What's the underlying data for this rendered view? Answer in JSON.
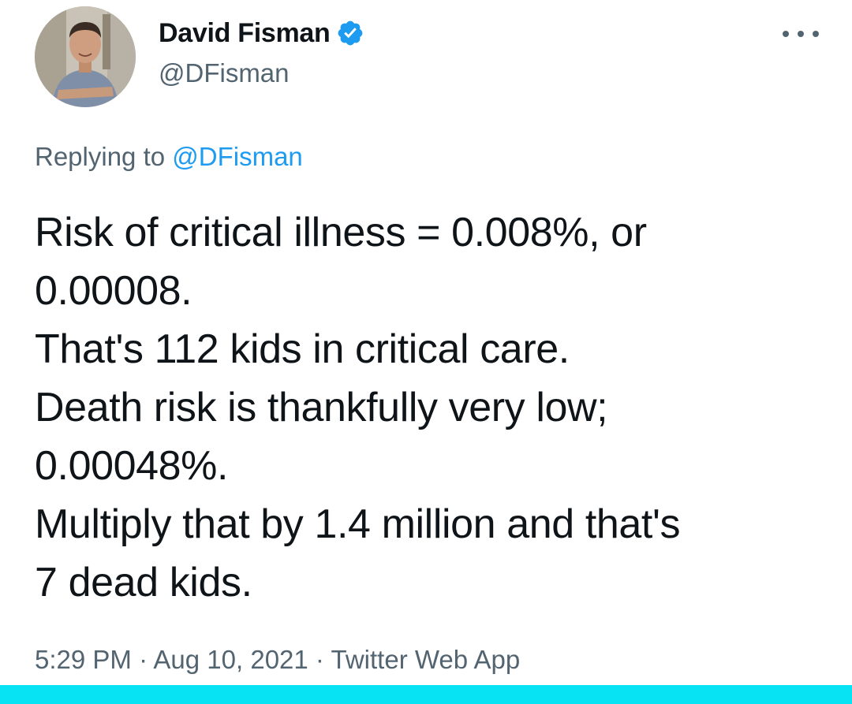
{
  "author": {
    "display_name": "David Fisman",
    "handle": "@DFisman",
    "verified": true
  },
  "reply": {
    "prefix": "Replying to ",
    "mention": "@DFisman"
  },
  "tweet": {
    "lines": [
      "Risk of critical illness = 0.008%, or",
      "0.00008.",
      "That's 112 kids in critical care.",
      "Death risk is thankfully very low;",
      "0.00048%.",
      "Multiply that by 1.4 million and that's",
      "7 dead kids."
    ]
  },
  "meta": {
    "time": "5:29 PM",
    "separator": " · ",
    "date": "Aug 10, 2021",
    "source": "Twitter Web App"
  },
  "icons": {
    "verified": "verified-badge-icon",
    "more": "more-options-icon"
  },
  "colors": {
    "verified_blue": "#1d9bf0",
    "mention_blue": "#1d9bf0",
    "secondary_text": "#536471",
    "bottom_bar": "#08e3f4"
  }
}
